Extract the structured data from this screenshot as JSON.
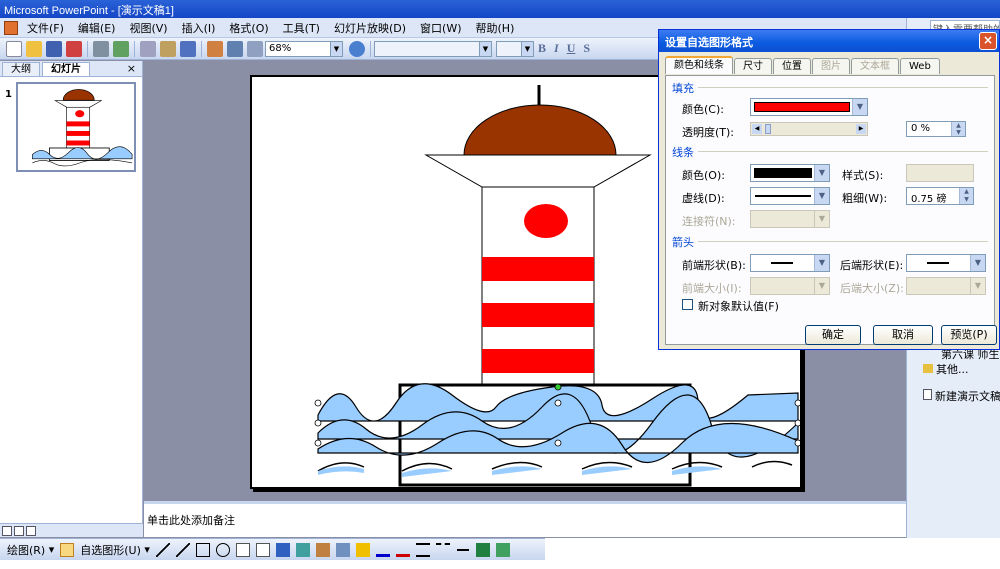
{
  "app": {
    "title": "Microsoft PowerPoint - [演示文稿1]"
  },
  "menu": {
    "items": [
      "文件(F)",
      "编辑(E)",
      "视图(V)",
      "插入(I)",
      "格式(O)",
      "工具(T)",
      "幻灯片放映(D)",
      "窗口(W)",
      "帮助(H)"
    ]
  },
  "toolbar": {
    "zoom": "68%",
    "bold": "B",
    "italic": "I",
    "underline": "U",
    "shadow": "S"
  },
  "panel": {
    "tab_outline": "大纲",
    "tab_slides": "幻灯片",
    "close": "×",
    "slide_number": "1"
  },
  "notes": {
    "placeholder": "单击此处添加备注"
  },
  "drawbar": {
    "draw_label": "绘图(R)",
    "autoshapes_label": "自选图形(U)"
  },
  "taskpane": {
    "help_text": "键入需要帮助的问题",
    "item1": "第六课 师生才",
    "item2": "其他...",
    "item3": "新建演示文稿"
  },
  "dialog": {
    "title": "设置自选图形格式",
    "close": "×",
    "tabs": [
      {
        "label": "颜色和线条",
        "state": "active"
      },
      {
        "label": "尺寸",
        "state": "normal"
      },
      {
        "label": "位置",
        "state": "normal"
      },
      {
        "label": "图片",
        "state": "disabled"
      },
      {
        "label": "文本框",
        "state": "disabled"
      },
      {
        "label": "Web",
        "state": "normal"
      }
    ],
    "fill": {
      "section": "填充",
      "color_label": "颜色(C):",
      "color_value": "#ff0000",
      "transparency_label": "透明度(T):",
      "transparency_value": "0 %"
    },
    "line": {
      "section": "线条",
      "color_label": "颜色(O):",
      "color_value": "#000000",
      "style_label": "样式(S):",
      "dashed_label": "虚线(D):",
      "weight_label": "粗细(W):",
      "weight_value": "0.75 磅",
      "connector_label": "连接符(N):"
    },
    "arrows": {
      "section": "箭头",
      "begin_style_label": "前端形状(B):",
      "end_style_label": "后端形状(E):",
      "begin_size_label": "前端大小(I):",
      "end_size_label": "后端大小(Z):"
    },
    "default_checkbox": "新对象默认值(F)",
    "ok": "确定",
    "cancel": "取消",
    "preview": "预览(P)"
  },
  "colors": {
    "lighthouse_red": "#ff0000",
    "dome_brown": "#993300",
    "wave_blue": "#99ccff",
    "accent_blue": "#0046d5"
  }
}
